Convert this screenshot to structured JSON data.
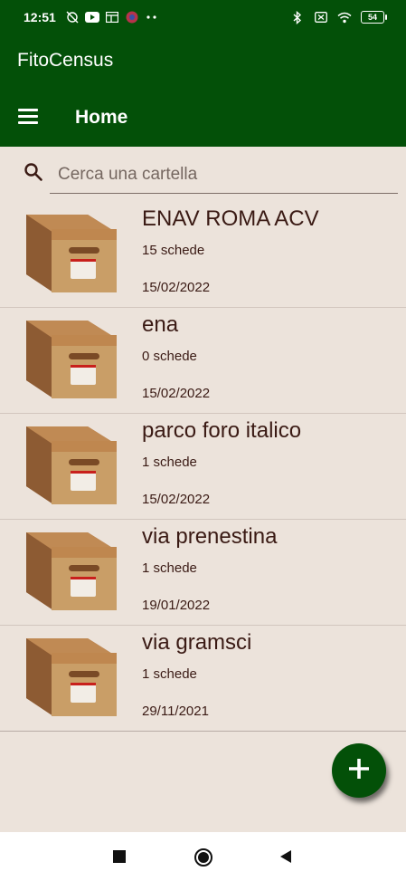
{
  "status_bar": {
    "time": "12:51",
    "battery": "54",
    "icons": [
      "alarm-off-icon",
      "youtube-icon",
      "cast-icon",
      "app-icon",
      "more-dots-icon",
      "bluetooth-icon",
      "sim-x-icon",
      "wifi-icon",
      "battery-icon"
    ]
  },
  "app": {
    "title": "FitoCensus"
  },
  "toolbar": {
    "title": "Home",
    "menu_icon": "hamburger-menu-icon"
  },
  "search": {
    "placeholder": "Cerca una cartella",
    "value": ""
  },
  "folders": [
    {
      "name": "ENAV ROMA ACV",
      "count": "15 schede",
      "date": "15/02/2022"
    },
    {
      "name": "ena",
      "count": "0 schede",
      "date": "15/02/2022"
    },
    {
      "name": "parco foro italico",
      "count": "1 schede",
      "date": "15/02/2022"
    },
    {
      "name": "via prenestina",
      "count": "1 schede",
      "date": "19/01/2022"
    },
    {
      "name": "via gramsci",
      "count": "1 schede",
      "date": "29/11/2021"
    }
  ],
  "fab": {
    "icon": "plus-icon"
  },
  "nav": {
    "icons": [
      "recents-square-icon",
      "home-circle-icon",
      "back-triangle-icon"
    ]
  },
  "colors": {
    "primary": "#035008",
    "background": "#ece3db",
    "text": "#3a1a14"
  }
}
